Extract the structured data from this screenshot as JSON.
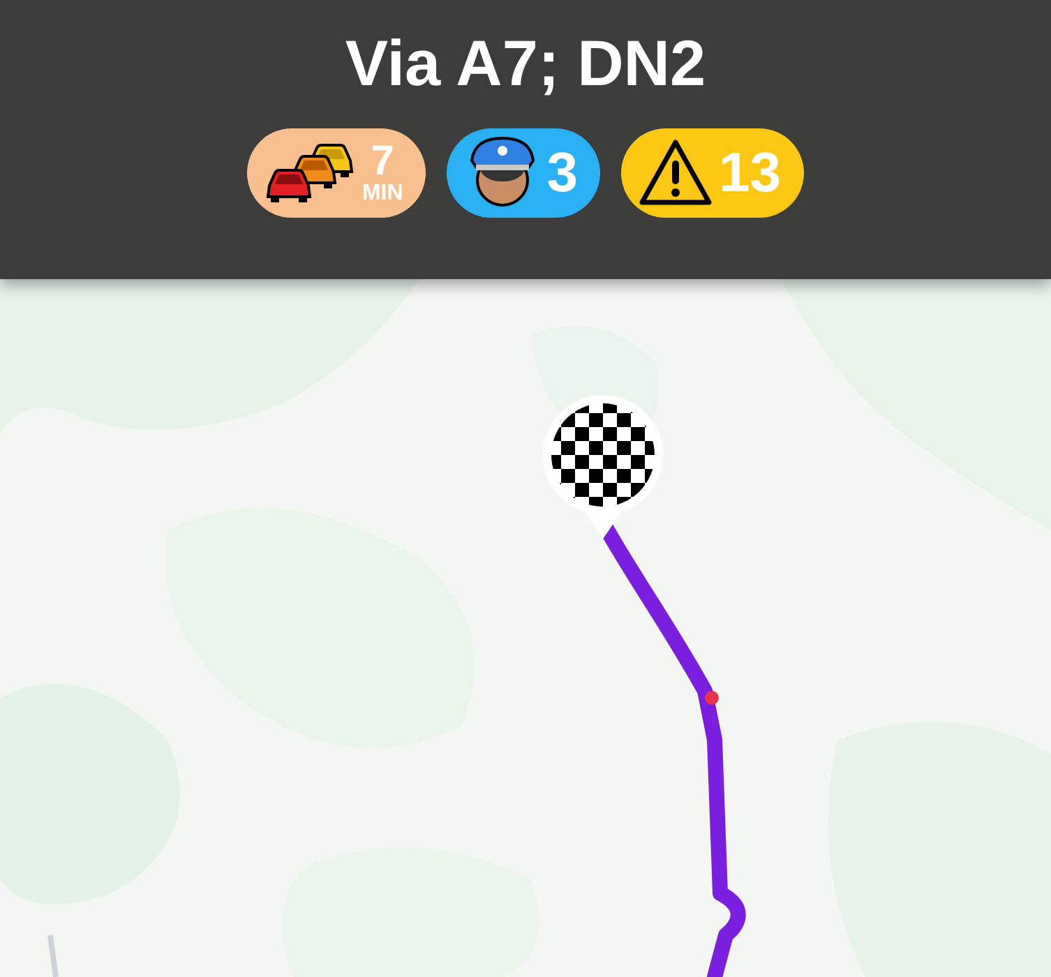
{
  "header": {
    "title": "Via A7; DN2"
  },
  "badges": [
    {
      "kind": "traffic",
      "color": "#f9c08f",
      "value": "7",
      "unit": "MIN"
    },
    {
      "kind": "police",
      "color": "#2ab0f5",
      "value": "3"
    },
    {
      "kind": "hazard",
      "color": "#fdc814",
      "value": "13"
    }
  ]
}
